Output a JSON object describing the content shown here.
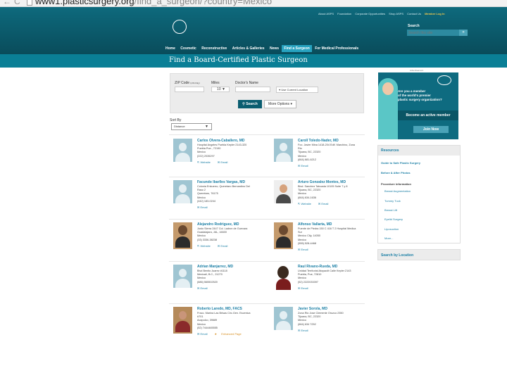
{
  "browser": {
    "back": "←",
    "reload": "C",
    "url_host": "www1.plasticsurgery.org",
    "url_path": "/find_a_surgeon/?country=Mexico"
  },
  "utility_nav": [
    "About ASPS",
    "Foundation",
    "Corporate Opportunities",
    "Shop ASPS",
    "Contact Us"
  ],
  "member_login": "Member Log In",
  "search": {
    "label": "Search",
    "placeholder": "Search this site",
    "button": "»"
  },
  "main_nav": [
    "Home",
    "Cosmetic",
    "Reconstructive",
    "Articles & Galleries",
    "News",
    "Find a Surgeon",
    "For Medical Professionals"
  ],
  "page_title": "Find a Board-Certified Plastic Surgeon",
  "form": {
    "zip_label": "ZIP Code",
    "zip_hint": "(US Only)",
    "miles_label": "Miles",
    "miles_value": "10",
    "doctor_label": "Doctor's Name",
    "location_button": "Use Current Location",
    "search_button": "Search",
    "more_options": "More Options"
  },
  "sort": {
    "label": "Sort By",
    "value": "Distance"
  },
  "doctors": [
    {
      "name": "Carlos Olvera-Caballero, MD",
      "lines": [
        "Hospital Angeles Puebla Kepler 2143-320",
        "Puebla Pue., 72190",
        "Mexico",
        "(222) 2035297"
      ],
      "links": [
        "Website",
        "Email"
      ]
    },
    {
      "name": "Caroll Toledo-Nader, MD",
      "lines": [
        "Fco. Javier Mina 1418-204 Edif. Marchino, Zona",
        "Rio",
        "Tijuana, BC, 22320",
        "Mexico",
        "(664) 681-6212"
      ],
      "links": [
        "Email"
      ]
    },
    {
      "name": "Facundo Ibarlles Vargas, MD",
      "lines": [
        "Colonia Enkuerro, Queretaro Bernardino Del",
        "Raso 2",
        "Queretaro, 76175",
        "Mexico",
        "(442) 183-0244"
      ],
      "links": [
        "Email"
      ]
    },
    {
      "name": "Arturo Gonzalez Montes, MD",
      "lines": [
        "Blvd. Sanchez Taboada 10105 Suite 7 y 8",
        "Tijuana, BC, 22320",
        "Mexico",
        "(664) 634-1636"
      ],
      "links": [
        "Website",
        "Email"
      ]
    },
    {
      "name": "Alejandro Rodriguez, MD",
      "lines": [
        "Justo Sierra 2447 Col. Ladron de Guevara",
        "Guadalajara, JAL, 44600",
        "Mexico",
        "(33) 3336-38238"
      ],
      "links": [
        "Website",
        "Email"
      ]
    },
    {
      "name": "Alfonso Vallarta, MD",
      "lines": [
        "Puente de Piedra 150 C 416 T 2 Hospital Medica",
        "Sur",
        "Mexico City, 14050",
        "Mexico",
        "(555) 528-4468"
      ],
      "links": [
        "Email"
      ]
    },
    {
      "name": "Adrian Manjarrez, MD",
      "lines": [
        "Blvd Benito Juarez #1118",
        "Mexicali, B.C., 21270",
        "Mexico",
        "(686) 565502520"
      ],
      "links": [
        "Email"
      ]
    },
    {
      "name": "Raul Rivano-Rueda, MD",
      "lines": [
        "Unidad Territorial Atoyac#t Calle Kepler 2143",
        "Puebla, Pue, 72810",
        "Mexico",
        "(52) 2222033397"
      ],
      "links": [
        "Email"
      ]
    },
    {
      "name": "Roberto Laredo, MD, FACS",
      "lines": [
        "Fracc. Marina Las Brisas Circ.Gen. Escenica",
        "#701",
        "Acapulco, 39689",
        "Mexico",
        "(52) 7444465555"
      ],
      "links": [
        "Email",
        "Enhanced Page"
      ]
    },
    {
      "name": "Javier Sorola, MD",
      "lines": [
        "Zona Rio Jose Clemente Orozco 2350",
        "Tijuana, BC, 22320",
        "Mexico",
        "(664) 634 7252"
      ],
      "links": [
        "Email"
      ]
    }
  ],
  "ad": {
    "label": "Advertisement",
    "message": [
      "Are you a member",
      "of the world's premier",
      "plastic surgery organization?"
    ],
    "band": "Become an active member",
    "button": "Join Now"
  },
  "resources": {
    "title": "Resources",
    "items": [
      "Guide to Safe Plastic Surgery",
      "Before & After Photos"
    ],
    "procedure_header": "Procedure information",
    "procedures": [
      "Breast Augmentation",
      "Tummy Tuck",
      "Breast Lift",
      "Eyelid Surgery",
      "Liposuction",
      "More..."
    ]
  },
  "search_by_location": "Search by Location",
  "colors": {
    "header": "#0b5e70",
    "title_bar": "#0a7f96",
    "link": "#1b7fa5",
    "active_tab": "#28a3c0"
  }
}
